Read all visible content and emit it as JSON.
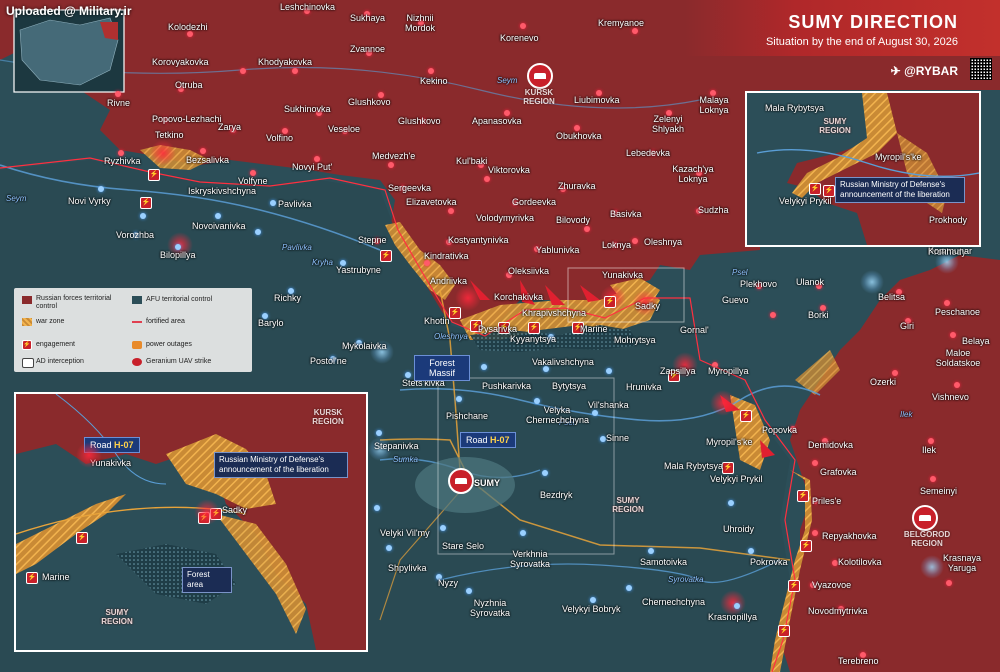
{
  "uploaded": "Uploaded @ Military.ir",
  "header": {
    "title": "SUMY DIRECTION",
    "subtitle": "Situation by the end of August 30, 2026",
    "brand": "@RYBAR"
  },
  "colors": {
    "russian": "#8a2a2c",
    "afu": "#2c4e58",
    "war_zone": "#e8a040",
    "engagement": "#c8202a",
    "road": "#e8a33a"
  },
  "legend": {
    "russian": "Russian forces territorial control",
    "afu": "AFU territorial control",
    "war_zone": "war zone",
    "fortified": "fortified area",
    "engagement": "engagement",
    "power": "power outages",
    "ad": "AD interception",
    "geranium": "Geranium UAV strike"
  },
  "regions": {
    "kursk": "KURSK REGION",
    "sumy": "SUMY REGION",
    "belgorod": "BELGOROD REGION"
  },
  "roads": {
    "main": "Road",
    "code": "H-07"
  },
  "forest_massif": "Forest Massif",
  "rivers": {
    "seym1": "Seym",
    "seym2": "Seym",
    "psel1": "Psel",
    "psel2": "Psel",
    "sumka": "Sumka",
    "oleshnya": "Oleshnya",
    "syrovatka": "Syrovatka",
    "pavlivka": "Pavlivka",
    "krynka": "Kryha"
  },
  "places": {
    "leshchinovka": "Leshchinovka",
    "sukhaya": "Sukhaya",
    "nizhnii_mordok": "Nizhnii Mordok",
    "korenevo": "Korenevo",
    "kremyanoe": "Kremyanoe",
    "kolodezhi": "Kolodezhi",
    "korovyakovka": "Korovyakovka",
    "khodyakovka": "Khodyakovka",
    "zvannoe": "Zvannoe",
    "kekino": "Kekino",
    "otruba": "Otruba",
    "glushkovo": "Glushkovo",
    "rivne": "Rivne",
    "popovo_lezhachi": "Popovo-Lezhachi",
    "sukhinovka": "Sukhinovka",
    "liubimovka": "Liubimovka",
    "malaya_loknya": "Malaya Loknya",
    "tetkino": "Tetkino",
    "zarya": "Zarya",
    "volfino": "Volfino",
    "veseloe": "Veseloe",
    "glushkovo2": "Glushkovo",
    "apanasovka": "Apanasovka",
    "obukhovka": "Obukhovka",
    "zelenyi_shlyakh": "Zelenyi Shlyakh",
    "ryzhivka": "Ryzhivka",
    "bezsalivka": "Bezsalivka",
    "novyi_put": "Novyi Put'",
    "medvezhe": "Medvezh'e",
    "kulbaki": "Kul'baki",
    "lebedevka": "Lebedevka",
    "volfyne": "Volfyne",
    "iskryskivshchyna": "Iskryskivshchyna",
    "sergeevka": "Sergeevka",
    "viktorovka": "Viktorovka",
    "kazachya_loknya": "Kazach'ya Loknya",
    "zhuravka": "Zhuravka",
    "novi_vyrky": "Novi Vyrky",
    "pavlivka": "Pavlivka",
    "elizavetovka": "Elizavetovka",
    "gordeevka": "Gordeevka",
    "volodymyrivka": "Volodymyrivka",
    "bilovody": "Bilovody",
    "basivka": "Basivka",
    "sudzha": "Sudzha",
    "vorozhba": "Vorozhba",
    "novoivanivka": "Novoivanivka",
    "stepne": "Stepne",
    "kostyantynivka": "Kostyantynivka",
    "yablunivka": "Yablunivka",
    "loknya": "Loknya",
    "oleshnya": "Oleshnya",
    "bilopillya": "Bilopillya",
    "kindrativka": "Kindrativka",
    "yastrubyne": "Yastrubyne",
    "oleksiivka": "Oleksiivka",
    "yunakivka": "Yunakivka",
    "plekhovo": "Plekhovo",
    "ulanok": "Ulanok",
    "kommunar": "Kommunar",
    "andriivka": "Andriivka",
    "korchakivka": "Korchakivka",
    "guevo": "Guevo",
    "belitsa": "Belitsa",
    "richky": "Richky",
    "khrapivshchyna": "Khrapivshchyna",
    "sadky": "Sadky",
    "borki": "Borki",
    "peschanoe": "Peschanoe",
    "barylo": "Barylo",
    "khotin": "Khotin",
    "pysarivka": "Pysarivka",
    "marine": "Marine",
    "gornal": "Gornal'",
    "giri": "Giri",
    "kyyanytsya": "Kyyanytsya",
    "mohrytsya": "Mohrytsya",
    "belaya": "Belaya",
    "maloe_soldatskoe": "Maloe Soldatskoe",
    "mykolaivka": "Mykolaivka",
    "postolne": "Postol'ne",
    "vakalivshchyna": "Vakalivshchyna",
    "zapsillya": "Zapsillya",
    "myropillya": "Myropillya",
    "ozerki": "Ozerki",
    "pushkarivka": "Pushkarivka",
    "bytytsya": "Bytytsya",
    "hrunivka": "Hrunivka",
    "vishnevo": "Vishnevo",
    "stets_kivka": "Stets'kivka",
    "ilek_river": "Ilek",
    "pishchane": "Pishchane",
    "velyka_chernechchyna": "Velyka Chernechchyna",
    "vilshanka": "Vil'shanka",
    "popovka": "Popovka",
    "demidovka": "Demidovka",
    "ilek": "Ilek",
    "stepanivka": "Stepanivka",
    "sinne": "Sinne",
    "myropilske": "Myropil's'ke",
    "grafovka": "Grafovka",
    "mala_rybytsya": "Mala Rybytsya",
    "velykyi_prykil": "Velykyi Prykil",
    "sumy": "SUMY",
    "prilese": "Priles'e",
    "semeinyi": "Semeinyi",
    "bezdryk": "Bezdryk",
    "uhroidy": "Uhroidy",
    "repyakhovka": "Repyakhovka",
    "velyki_vilmy": "Velyki Vil'my",
    "stare_selo": "Stare Selo",
    "verkhnia_syrovatka": "Verkhnia Syrovatka",
    "kolotilovka": "Kolotilovka",
    "shpylivka": "Shpylivka",
    "samotoivka": "Samotoivka",
    "pokrovka": "Pokrovka",
    "krasnaya_yaruga": "Krasnaya Yaruga",
    "vyazovoe": "Vyazovoe",
    "nyzy": "Nyzy",
    "chernechchyna": "Chernechchyna",
    "nyzhnia_syrovatka": "Nyzhnia Syrovatka",
    "novodmytrivka": "Novodmytrivka",
    "velykyi_bobryk": "Velykyi Bobryk",
    "krasnopillya": "Krasnopillya",
    "terebreno": "Terebreno"
  },
  "inset_ne": {
    "mala_rybytsya": "Mala Rybytsya",
    "region": "SUMY REGION",
    "myropilske": "Myropil's'ke",
    "velykyi_prykil": "Velykyi Prykil",
    "prokhody": "Prokhody",
    "announcement": "Russian Ministry of Defense's announcement of the liberation"
  },
  "inset_sw": {
    "kursk": "KURSK REGION",
    "sumy": "SUMY REGION",
    "road": "Road",
    "road_code": "H-07",
    "yunakivka": "Yunakivka",
    "sadky": "Sadky",
    "marine": "Marine",
    "forest": "Forest area",
    "announcement": "Russian Ministry of Defense's announcement of the liberation"
  }
}
